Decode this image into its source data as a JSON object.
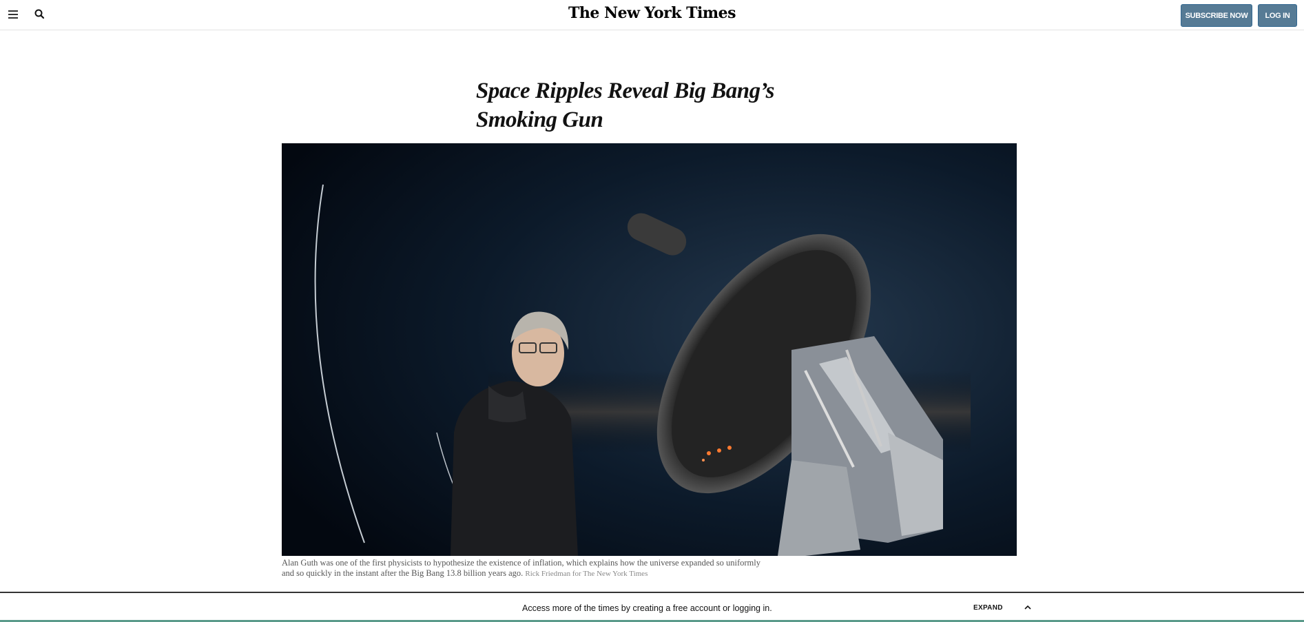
{
  "header": {
    "logo_text": "The New York Times",
    "subscribe_label": "SUBSCRIBE NOW",
    "login_label": "LOG IN",
    "menu_icon": "hamburger-menu-icon",
    "search_icon": "search-icon",
    "button_color": "#567b95"
  },
  "article": {
    "headline_line1": "Space Ripples Reveal Big Bang’s",
    "headline_line2": "Smoking Gun",
    "caption": "Alan Guth was one of the first physicists to hypothesize the existence of inflation, which explains how the universe expanded so uniformly and so quickly in the instant after the Big Bang 13.8 billion years ago.",
    "credit": "Rick Friedman for The New York Times"
  },
  "banner": {
    "text": "Access more of the times by creating a free account or logging in.",
    "expand_label": "EXPAND",
    "chevron_icon": "chevron-up-icon"
  }
}
